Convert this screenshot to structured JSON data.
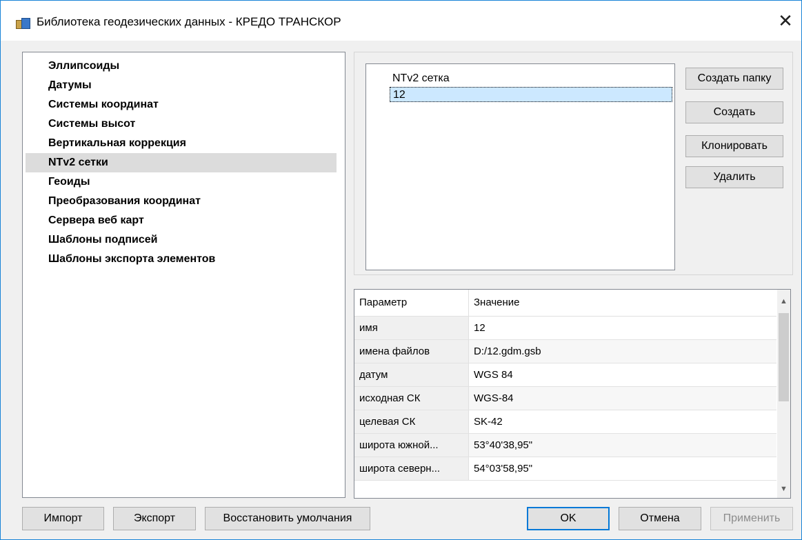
{
  "window": {
    "title": "Библиотека геодезических данных - КРЕДО ТРАНСКОР",
    "close_glyph": "✕",
    "accent_color": "#0078d7"
  },
  "categories": [
    {
      "label": "Эллипсоиды"
    },
    {
      "label": "Датумы"
    },
    {
      "label": "Системы координат"
    },
    {
      "label": "Системы высот"
    },
    {
      "label": "Вертикальная коррекция"
    },
    {
      "label": "NTv2 сетки",
      "selected": true
    },
    {
      "label": "Геоиды"
    },
    {
      "label": "Преобразования координат"
    },
    {
      "label": "Сервера веб карт"
    },
    {
      "label": "Шаблоны подписей"
    },
    {
      "label": "Шаблоны экспорта элементов"
    }
  ],
  "tree": {
    "root_label": "NTv2 сетка",
    "child_label": "12"
  },
  "side_buttons": {
    "create_folder": "Создать папку",
    "create": "Создать",
    "clone": "Клонировать",
    "delete": "Удалить"
  },
  "properties": {
    "columns": [
      "Параметр",
      "Значение"
    ],
    "rows": [
      {
        "param": "имя",
        "value": "12"
      },
      {
        "param": "имена файлов",
        "value": "D:/12.gdm.gsb"
      },
      {
        "param": "датум",
        "value": "WGS 84"
      },
      {
        "param": "исходная СК",
        "value": "WGS-84"
      },
      {
        "param": "целевая СК",
        "value": "SK-42"
      },
      {
        "param": "широта южной...",
        "value": "53°40'38,95\""
      },
      {
        "param": "широта северн...",
        "value": "54°03'58,95\""
      }
    ]
  },
  "bottom_buttons": {
    "import": "Импорт",
    "export": "Экспорт",
    "restore_defaults": "Восстановить умолчания",
    "ok": "OK",
    "cancel": "Отмена",
    "apply": "Применить"
  }
}
